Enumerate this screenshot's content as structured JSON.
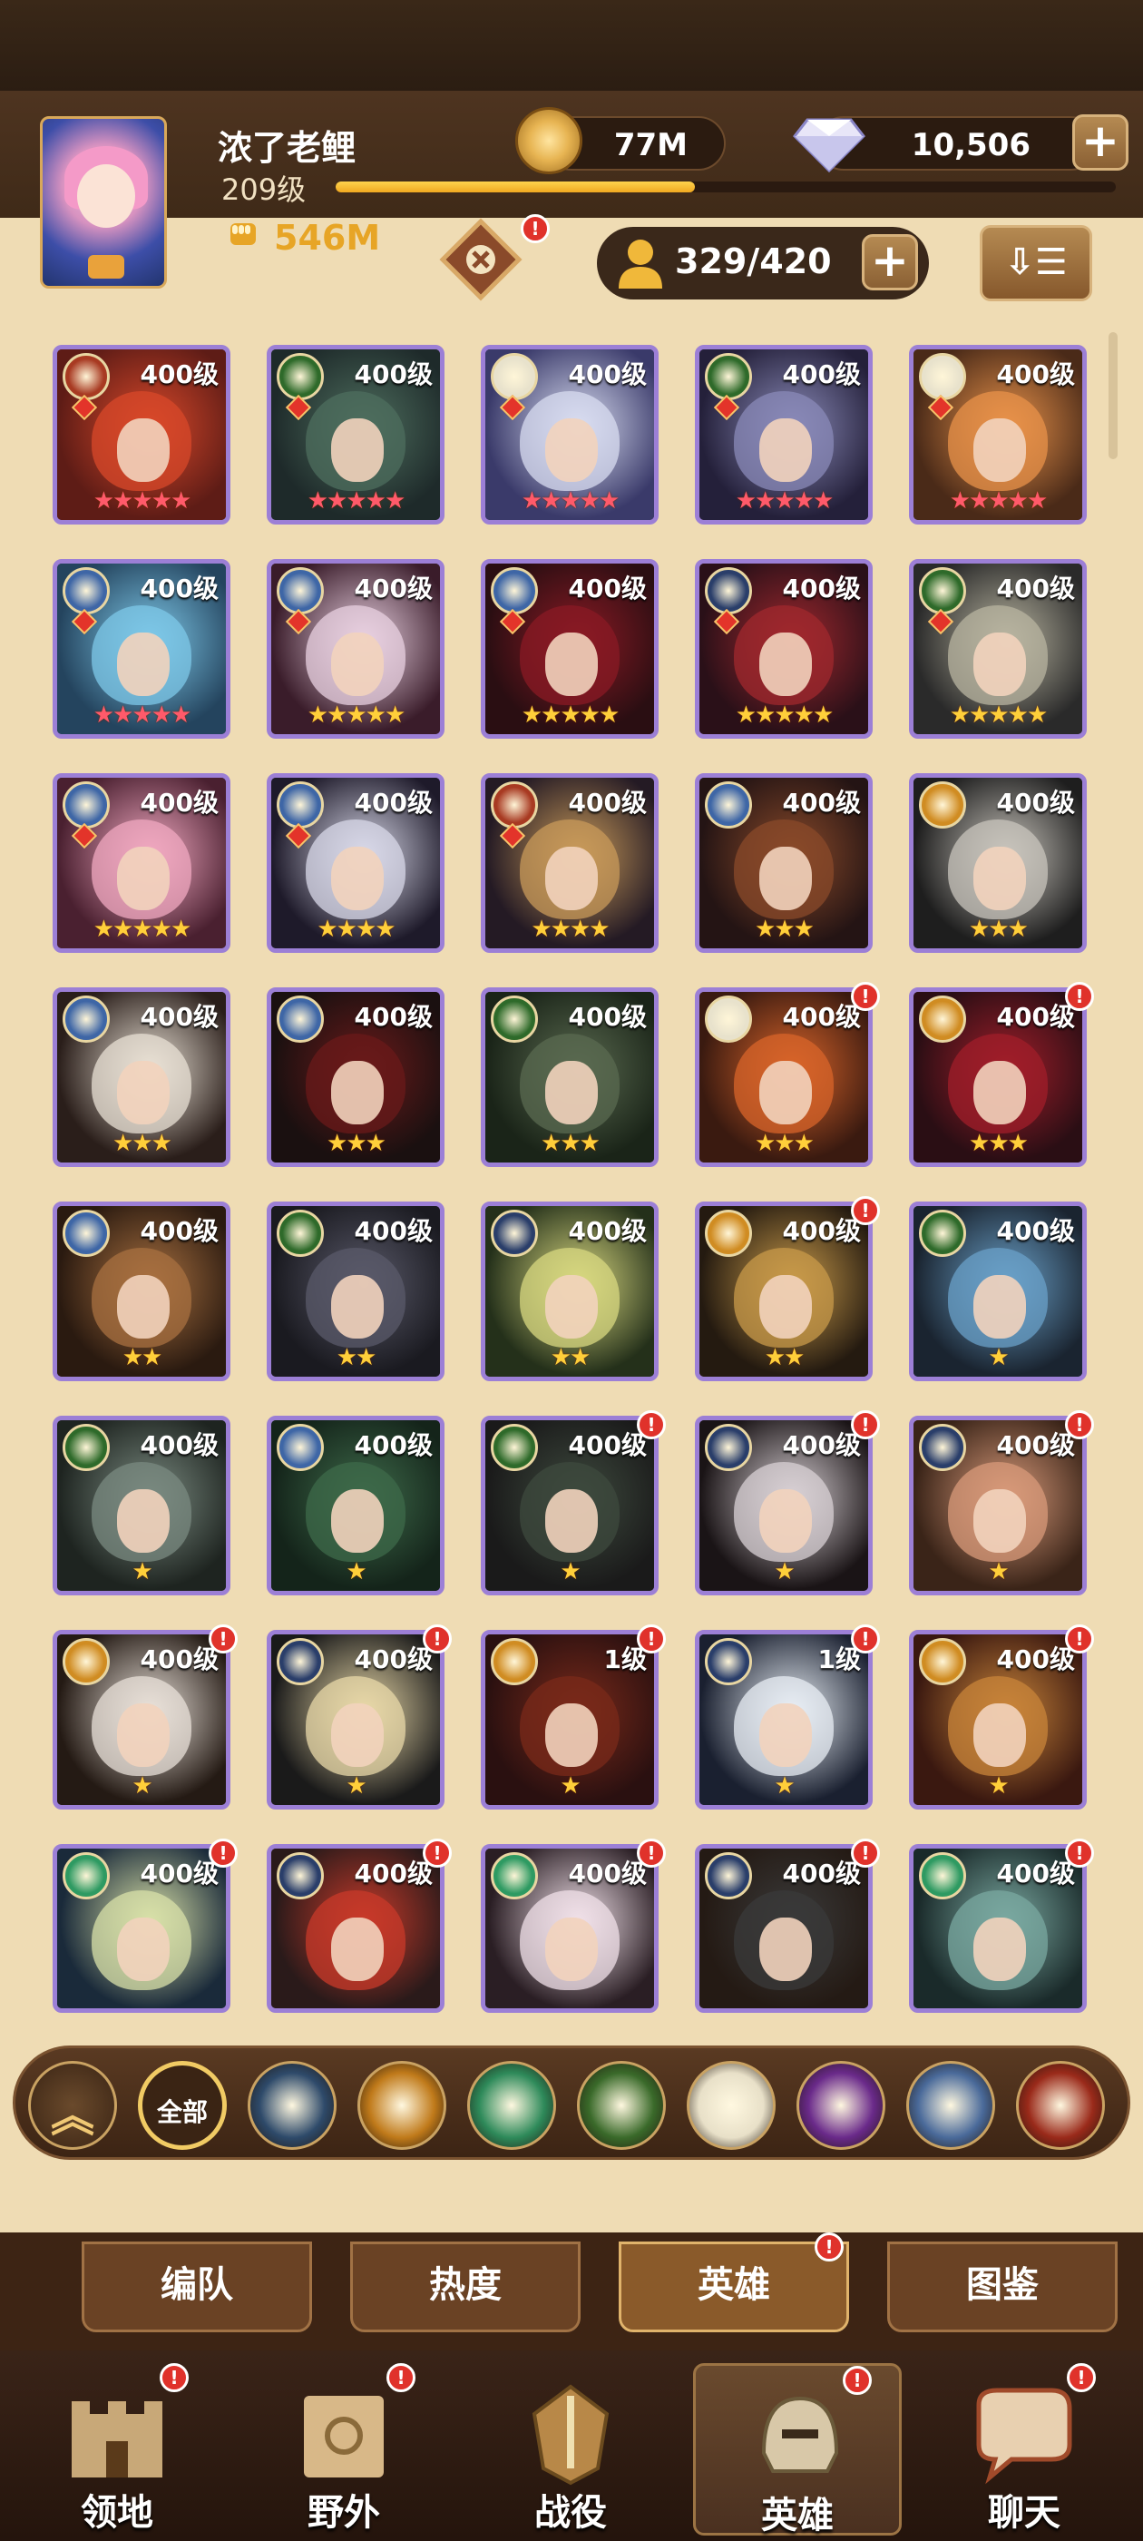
{
  "player": {
    "name": "浓了老鲤",
    "level": "209级",
    "xp_progress": 0.46,
    "power": "546M"
  },
  "currency": {
    "gold": "77M",
    "diamonds": "10,506"
  },
  "hero_count": "329/420",
  "colors": {
    "accent": "#e7a526",
    "red_dot": "#e0322b",
    "card_border": "#9c7fd6",
    "background": "#efdcb4"
  },
  "heroes": [
    {
      "level": "400级",
      "stars": 5,
      "star_color": "red",
      "faction": "graveborn",
      "palette": [
        "#5e1c16",
        "#d8482a"
      ]
    },
    {
      "level": "400级",
      "stars": 5,
      "star_color": "red",
      "faction": "mauler",
      "palette": [
        "#1e2a2a",
        "#4e6e5e"
      ]
    },
    {
      "level": "400级",
      "stars": 5,
      "star_color": "red",
      "faction": "celestial",
      "palette": [
        "#3a3a6a",
        "#d8dcf0"
      ]
    },
    {
      "level": "400级",
      "stars": 5,
      "star_color": "red",
      "faction": "mauler",
      "palette": [
        "#24203a",
        "#8a8ab8"
      ]
    },
    {
      "level": "400级",
      "stars": 5,
      "star_color": "red",
      "faction": "celestial",
      "palette": [
        "#4a2a18",
        "#e8924a"
      ]
    },
    {
      "level": "400级",
      "stars": 5,
      "star_color": "red",
      "faction": "lightbearer",
      "palette": [
        "#24445e",
        "#7ec8e8"
      ]
    },
    {
      "level": "400级",
      "stars": 5,
      "star_color": "gold",
      "faction": "lightbearer",
      "palette": [
        "#3a1c2a",
        "#e8d0e0"
      ]
    },
    {
      "level": "400级",
      "stars": 5,
      "star_color": "gold",
      "faction": "lightbearer",
      "palette": [
        "#2a0e12",
        "#8a1a24"
      ]
    },
    {
      "level": "400级",
      "stars": 5,
      "star_color": "gold",
      "faction": "wilder",
      "palette": [
        "#2a1018",
        "#a0282e"
      ]
    },
    {
      "level": "400级",
      "stars": 5,
      "star_color": "gold",
      "faction": "mauler",
      "palette": [
        "#2a2a2a",
        "#b8b4a0"
      ]
    },
    {
      "level": "400级",
      "stars": 5,
      "star_color": "gold",
      "faction": "lightbearer",
      "palette": [
        "#4a2030",
        "#f0a8c0"
      ]
    },
    {
      "level": "400级",
      "stars": 4,
      "star_color": "gold",
      "faction": "lightbearer",
      "palette": [
        "#1e1a2a",
        "#d8d8e8"
      ]
    },
    {
      "level": "400级",
      "stars": 4,
      "star_color": "gold",
      "faction": "graveborn",
      "palette": [
        "#241a24",
        "#c89a5a"
      ]
    },
    {
      "level": "400级",
      "stars": 3,
      "star_color": "gold",
      "faction": "lightbearer",
      "palette": [
        "#241414",
        "#8a4a2a"
      ]
    },
    {
      "level": "400级",
      "stars": 3,
      "star_color": "gold",
      "faction": "dimensional",
      "palette": [
        "#1e1e1e",
        "#c8c4bc"
      ]
    },
    {
      "level": "400级",
      "stars": 3,
      "star_color": "gold",
      "faction": "lightbearer",
      "palette": [
        "#2a1e1a",
        "#e8e0d4"
      ]
    },
    {
      "level": "400级",
      "stars": 3,
      "star_color": "gold",
      "faction": "lightbearer",
      "palette": [
        "#1a1010",
        "#6a1a1a"
      ]
    },
    {
      "level": "400级",
      "stars": 3,
      "star_color": "gold",
      "faction": "mauler",
      "palette": [
        "#1a2418",
        "#5a6a50"
      ]
    },
    {
      "level": "400级",
      "stars": 3,
      "star_color": "gold",
      "faction": "celestial",
      "palette": [
        "#3a1a10",
        "#d8642a"
      ]
    },
    {
      "level": "400级",
      "stars": 3,
      "star_color": "gold",
      "faction": "dimensional",
      "palette": [
        "#2a0e14",
        "#a01e2a"
      ]
    },
    {
      "level": "400级",
      "stars": 2,
      "star_color": "gold",
      "faction": "lightbearer",
      "palette": [
        "#2a1a10",
        "#a87040"
      ]
    },
    {
      "level": "400级",
      "stars": 2,
      "star_color": "gold",
      "faction": "mauler",
      "palette": [
        "#1a1a20",
        "#5a5a6a"
      ]
    },
    {
      "level": "400级",
      "stars": 2,
      "star_color": "gold",
      "faction": "wilder",
      "palette": [
        "#24301a",
        "#d8d880"
      ]
    },
    {
      "level": "400级",
      "stars": 2,
      "star_color": "gold",
      "faction": "dimensional",
      "palette": [
        "#241a10",
        "#c89a4a"
      ]
    },
    {
      "level": "400级",
      "stars": 1,
      "star_color": "gold",
      "faction": "mauler",
      "palette": [
        "#1a2430",
        "#6aa0c8"
      ]
    },
    {
      "level": "400级",
      "stars": 1,
      "star_color": "gold",
      "faction": "mauler",
      "palette": [
        "#1e2420",
        "#7a8a80"
      ]
    },
    {
      "level": "400级",
      "stars": 1,
      "star_color": "gold",
      "faction": "lightbearer",
      "palette": [
        "#14241a",
        "#3e6a4a"
      ]
    },
    {
      "level": "400级",
      "stars": 1,
      "star_color": "gold",
      "faction": "mauler",
      "palette": [
        "#1a1a1a",
        "#3e4a3e"
      ]
    },
    {
      "level": "400级",
      "stars": 1,
      "star_color": "gold",
      "faction": "wilder",
      "palette": [
        "#1a1416",
        "#d8d0d4"
      ]
    },
    {
      "level": "400级",
      "stars": 1,
      "star_color": "gold",
      "faction": "wilder",
      "palette": [
        "#3a2418",
        "#d89a7a"
      ]
    },
    {
      "level": "400级",
      "stars": 1,
      "star_color": "gold",
      "faction": "dimensional",
      "palette": [
        "#241a14",
        "#e8e0d8"
      ]
    },
    {
      "level": "400级",
      "stars": 1,
      "star_color": "gold",
      "faction": "wilder",
      "palette": [
        "#1a1a1a",
        "#e8d8a8"
      ]
    },
    {
      "level": "1级",
      "stars": 1,
      "star_color": "gold",
      "faction": "dimensional",
      "palette": [
        "#2a1010",
        "#7a2a1a"
      ]
    },
    {
      "level": "1级",
      "stars": 1,
      "star_color": "gold",
      "faction": "wilder",
      "palette": [
        "#1a2030",
        "#e8eef4"
      ]
    },
    {
      "level": "400级",
      "stars": 1,
      "star_color": "gold",
      "faction": "dimensional",
      "palette": [
        "#3a1810",
        "#c8843a"
      ]
    },
    {
      "level": "400级",
      "stars": 0,
      "star_color": "gold",
      "faction": "hypogean",
      "palette": [
        "#1a2a3a",
        "#d8e0a8"
      ]
    },
    {
      "level": "400级",
      "stars": 0,
      "star_color": "gold",
      "faction": "wilder",
      "palette": [
        "#2a1a1a",
        "#c83a2a"
      ]
    },
    {
      "level": "400级",
      "stars": 0,
      "star_color": "gold",
      "faction": "hypogean",
      "palette": [
        "#2a1e24",
        "#f0e0e8"
      ]
    },
    {
      "level": "400级",
      "stars": 0,
      "star_color": "gold",
      "faction": "wilder",
      "palette": [
        "#241a14",
        "#3a3a3a"
      ]
    },
    {
      "level": "400级",
      "stars": 0,
      "star_color": "gold",
      "faction": "hypogean",
      "palette": [
        "#1a2a2a",
        "#7aa8a0"
      ]
    }
  ],
  "hero_alerts": [
    18,
    19,
    23,
    27,
    28,
    29,
    30,
    31,
    32,
    33,
    34,
    35,
    36,
    37,
    38,
    39
  ],
  "factions": [
    {
      "label": "",
      "name": "rank-up",
      "color": "#7a5230"
    },
    {
      "label": "全部",
      "name": "all",
      "color": "#4a2e18"
    },
    {
      "label": "",
      "name": "wilder-star",
      "color": "#2e4a6a"
    },
    {
      "label": "",
      "name": "dimensional",
      "color": "#c07a1a"
    },
    {
      "label": "",
      "name": "hypogean-leaf",
      "color": "#2e8a5a"
    },
    {
      "label": "",
      "name": "mauler-eye",
      "color": "#3a6a2a"
    },
    {
      "label": "",
      "name": "celestial-star",
      "color": "#e8e0c8"
    },
    {
      "label": "",
      "name": "hypogean-purple",
      "color": "#6a2a8a"
    },
    {
      "label": "",
      "name": "lightbearer",
      "color": "#4a6a9a"
    },
    {
      "label": "",
      "name": "graveborn-flame",
      "color": "#9a2a1a"
    }
  ],
  "subtabs": [
    {
      "label": "编队",
      "selected": false,
      "alert": false
    },
    {
      "label": "热度",
      "selected": false,
      "alert": false
    },
    {
      "label": "英雄",
      "selected": true,
      "alert": true
    },
    {
      "label": "图鉴",
      "selected": false,
      "alert": false
    }
  ],
  "nav": [
    {
      "label": "领地",
      "icon": "castle-icon",
      "selected": false,
      "alert": true
    },
    {
      "label": "野外",
      "icon": "map-scroll-icon",
      "selected": false,
      "alert": true
    },
    {
      "label": "战役",
      "icon": "sword-shield-icon",
      "selected": false,
      "alert": false
    },
    {
      "label": "英雄",
      "icon": "helmet-icon",
      "selected": true,
      "alert": true
    },
    {
      "label": "聊天",
      "icon": "chat-bubble-icon",
      "selected": false,
      "alert": true
    }
  ]
}
